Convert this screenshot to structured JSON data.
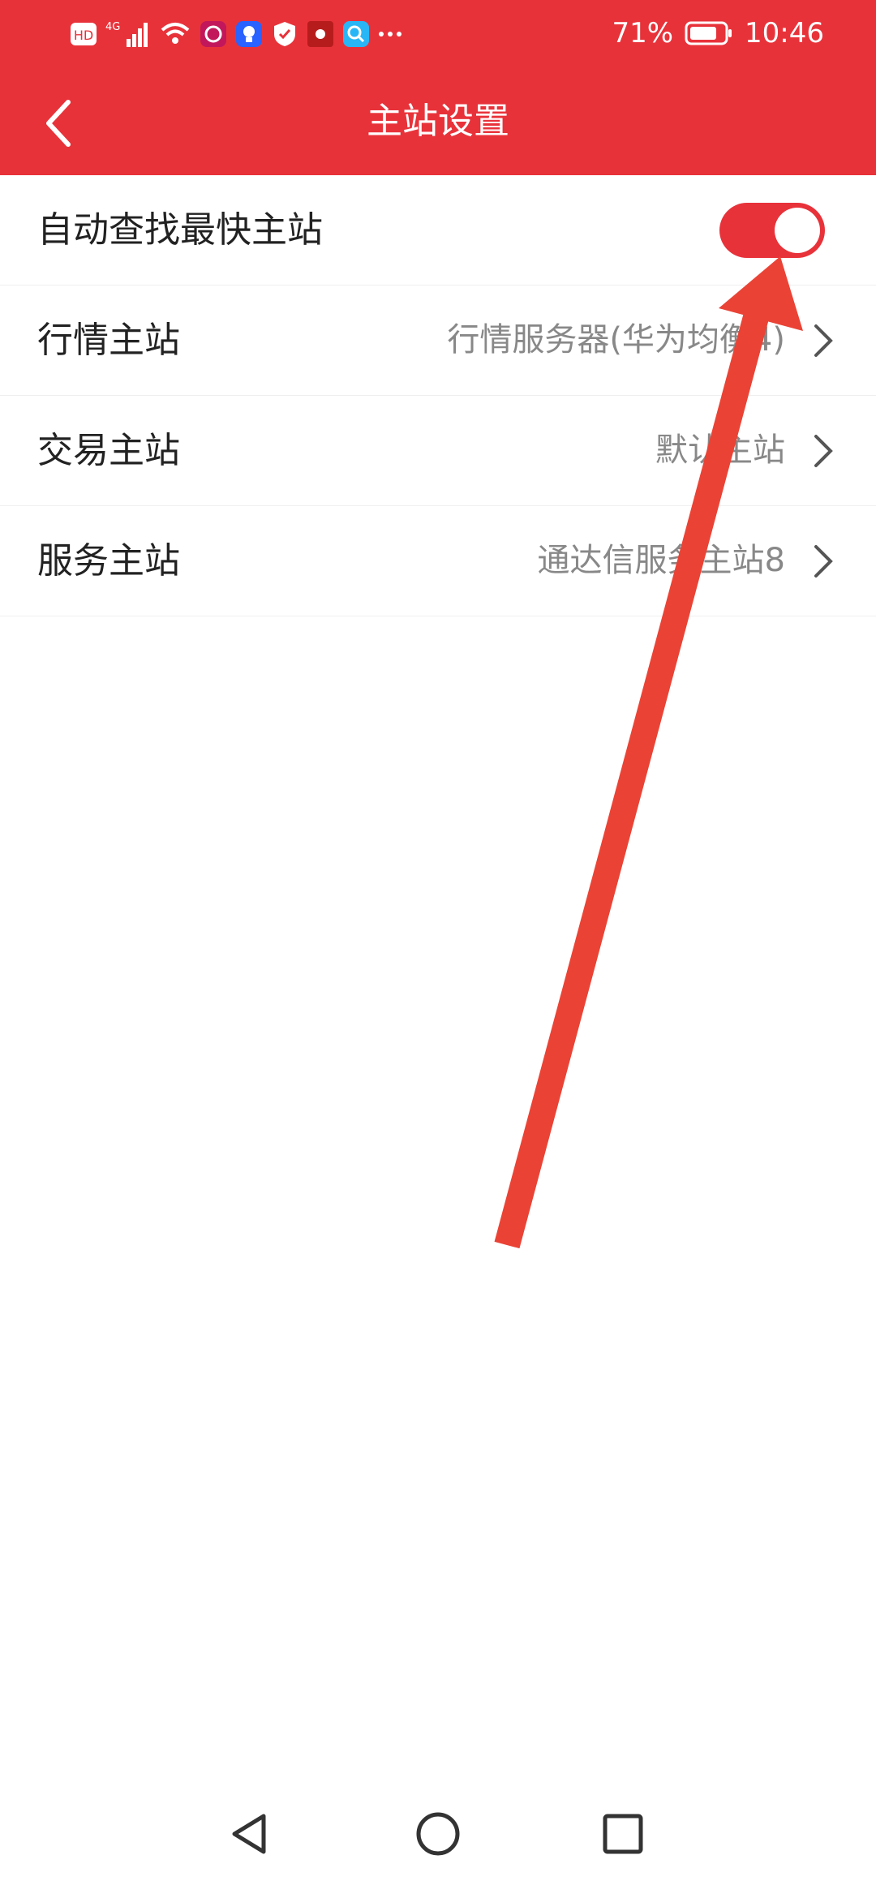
{
  "status_bar": {
    "hd": "HD",
    "network": "4G",
    "battery": "71%",
    "time": "10:46",
    "icons": [
      "hd-icon",
      "signal-icon",
      "wifi-icon",
      "app-icon",
      "bulb-icon",
      "shield-icon",
      "record-icon",
      "search-icon",
      "more-icon"
    ]
  },
  "header": {
    "title": "主站设置",
    "back_icon": "back-chevron-icon"
  },
  "settings": {
    "auto_find": {
      "label": "自动查找最快主站",
      "enabled": true
    },
    "market": {
      "label": "行情主站",
      "value": "行情服务器(华为均衡4)"
    },
    "trade": {
      "label": "交易主站",
      "value": "默认主站"
    },
    "service": {
      "label": "服务主站",
      "value": "通达信服务主站8"
    }
  },
  "nav": {
    "icons": [
      "back-triangle-icon",
      "home-circle-icon",
      "recent-square-icon"
    ]
  },
  "colors": {
    "accent": "#e8323a",
    "arrow": "#ea4335"
  }
}
